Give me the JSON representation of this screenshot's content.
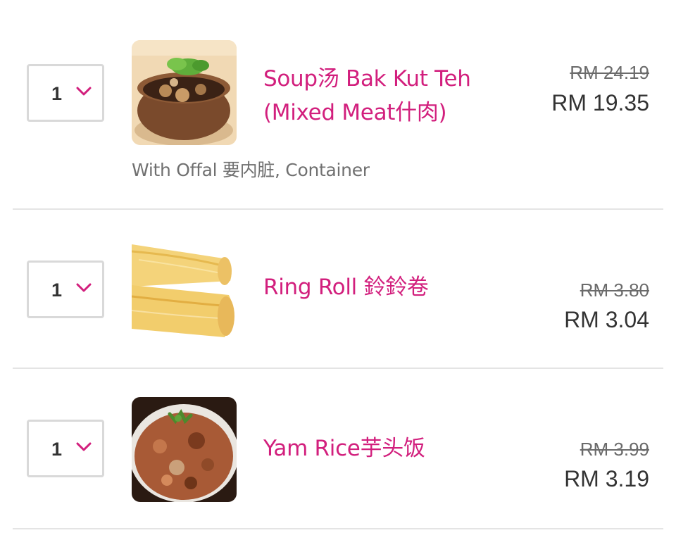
{
  "cart": {
    "items": [
      {
        "quantity": "1",
        "name_line1": "Soup汤 Bak Kut Teh",
        "name_line2": "(Mixed Meat什肉)",
        "options": "With Offal 要内脏, Container",
        "original_price": "RM 24.19",
        "price": "RM 19.35",
        "image": "bak-kut-teh-photo"
      },
      {
        "quantity": "1",
        "name_line1": "Ring Roll 鈴鈴卷",
        "original_price": "RM 3.80",
        "price": "RM 3.04",
        "image": "ring-roll-photo"
      },
      {
        "quantity": "1",
        "name_line1": "Yam Rice芋头饭",
        "original_price": "RM 3.99",
        "price": "RM 3.19",
        "image": "yam-rice-photo"
      }
    ]
  },
  "colors": {
    "accent": "#d21f7d",
    "price_text": "#333333",
    "strikethrough_text": "#6b6b6b",
    "divider": "#e4e4e4",
    "select_border": "#d9d9d9"
  },
  "icons": {
    "quantity_dropdown": "chevron-down-icon"
  }
}
